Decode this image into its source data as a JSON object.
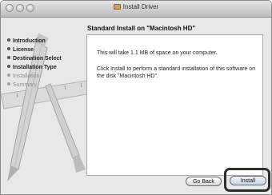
{
  "window": {
    "title": "Install Driver"
  },
  "heading": "Standard Install on \"Macintosh HD\"",
  "steps": [
    {
      "label": "Introduction",
      "state": "done"
    },
    {
      "label": "License",
      "state": "done"
    },
    {
      "label": "Destination Select",
      "state": "done"
    },
    {
      "label": "Installation Type",
      "state": "current"
    },
    {
      "label": "Installation",
      "state": "pending"
    },
    {
      "label": "Summary",
      "state": "pending"
    }
  ],
  "content": {
    "line1": "This will take 1.1 MB of space on your computer.",
    "line2": "Click Install to perform a standard installation of this software on the disk \"Macintosh HD\"."
  },
  "buttons": {
    "go_back": "Go Back",
    "install": "Install"
  },
  "icons": [
    "close-traffic-light-icon",
    "minimize-traffic-light-icon",
    "zoom-traffic-light-icon",
    "package-icon",
    "pencil-illustration-icon",
    "ruler-illustration-icon",
    "brush-illustration-icon"
  ],
  "colors": {
    "window_bg": "#e8e8e8",
    "panel_bg": "#ffffff",
    "highlight_outline": "#2c2c2c"
  }
}
